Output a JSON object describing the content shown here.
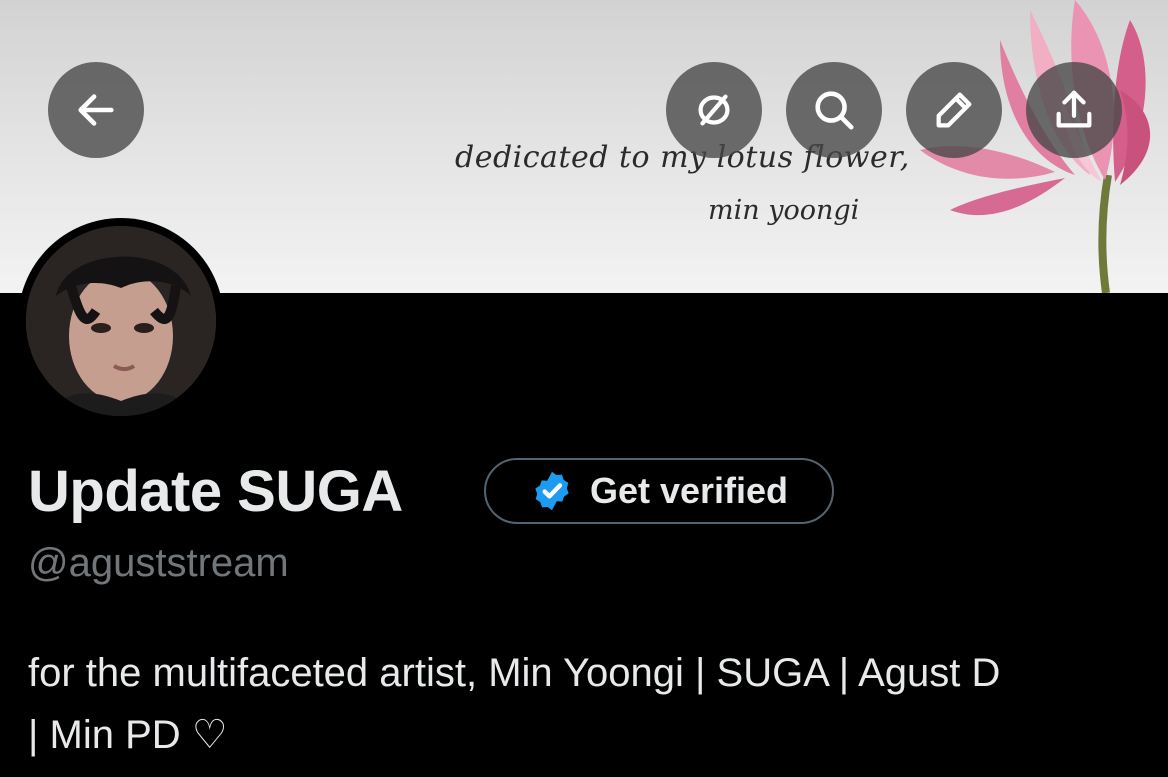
{
  "banner": {
    "line1": "dedicated to my lotus flower,",
    "line2": "min yoongi"
  },
  "toolbar": {
    "back_icon": "arrow-left-icon",
    "explore_icon": "compass-slash-icon",
    "search_icon": "search-icon",
    "edit_icon": "pencil-icon",
    "share_icon": "share-icon"
  },
  "profile": {
    "name": "Update SUGA",
    "handle": "@aguststream",
    "verify_label": "Get verified",
    "bio_line1": "for the multifaceted artist, Min Yoongi | SUGA | Agust D",
    "bio_line2": "| Min PD ♡"
  },
  "colors": {
    "background": "#000000",
    "verified_badge": "#1d9bf0",
    "secondary_text": "#71767b"
  }
}
